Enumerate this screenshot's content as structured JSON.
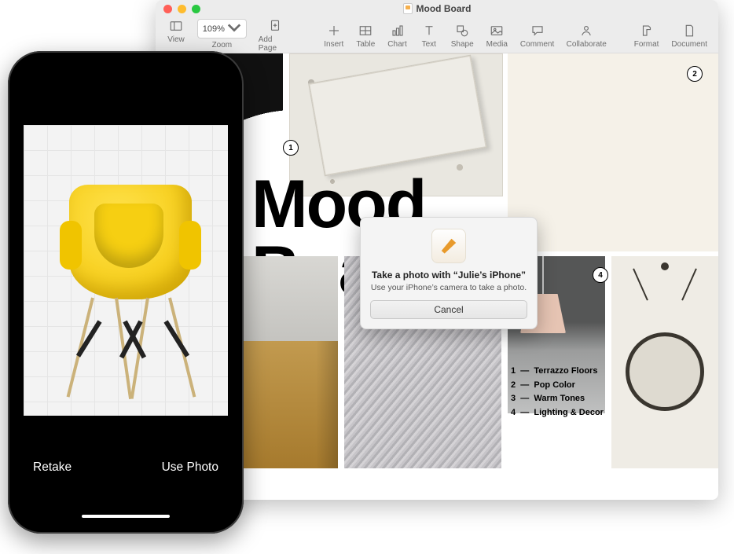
{
  "window": {
    "title": "Mood Board"
  },
  "toolbar": {
    "view": "View",
    "zoom_label": "Zoom",
    "zoom_value": "109%",
    "add_page": "Add Page",
    "insert": "Insert",
    "table": "Table",
    "chart": "Chart",
    "text": "Text",
    "shape": "Shape",
    "media": "Media",
    "comment": "Comment",
    "collaborate": "Collaborate",
    "format": "Format",
    "document": "Document"
  },
  "headline": {
    "line1": "Mood",
    "line2": "Board."
  },
  "tags": {
    "t1": "1",
    "t2": "2",
    "t4": "4"
  },
  "legend": {
    "items": [
      {
        "num": "1",
        "label": "Terrazzo Floors"
      },
      {
        "num": "2",
        "label": "Pop Color"
      },
      {
        "num": "3",
        "label": "Warm Tones"
      },
      {
        "num": "4",
        "label": "Lighting & Decor"
      }
    ]
  },
  "modal": {
    "title": "Take a photo with “Julie’s iPhone”",
    "subtitle": "Use your iPhone’s camera to take a photo.",
    "cancel": "Cancel"
  },
  "phone": {
    "retake": "Retake",
    "use_photo": "Use Photo"
  }
}
